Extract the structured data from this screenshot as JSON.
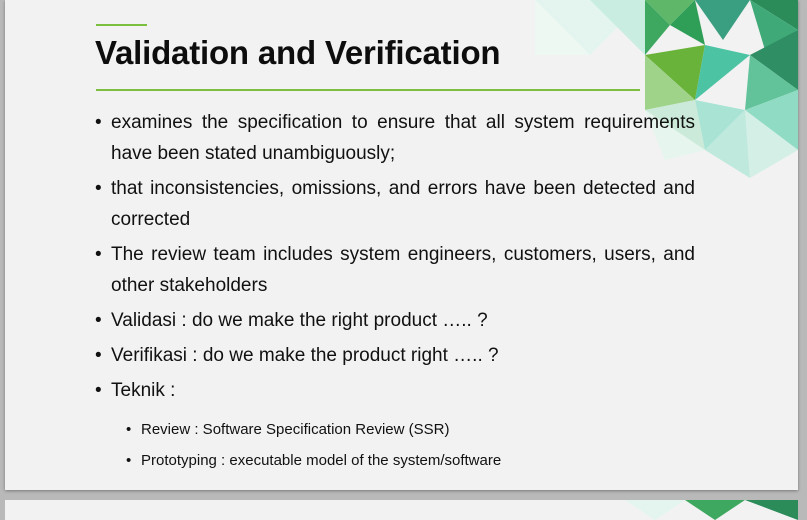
{
  "slide": {
    "title": "Validation and Verification",
    "bullets": [
      "examines the specification to ensure that all system requirements have been stated unambiguously;",
      "that inconsistencies, omissions, and errors have been detected and corrected",
      "The review team includes system engineers, customers, users, and other stakeholders",
      "Validasi : do we make the right product ….. ?",
      "Verifikasi : do we make the product right ….. ?",
      "Teknik :"
    ],
    "sub_bullets": [
      "Review : Software Specification Review (SSR)",
      "Prototyping : executable model of the system/software"
    ],
    "bullet_glyph": "•"
  },
  "colors": {
    "accent": "#7cbf3f",
    "background": "#f2f2f2",
    "title": "#0d0d0d"
  }
}
